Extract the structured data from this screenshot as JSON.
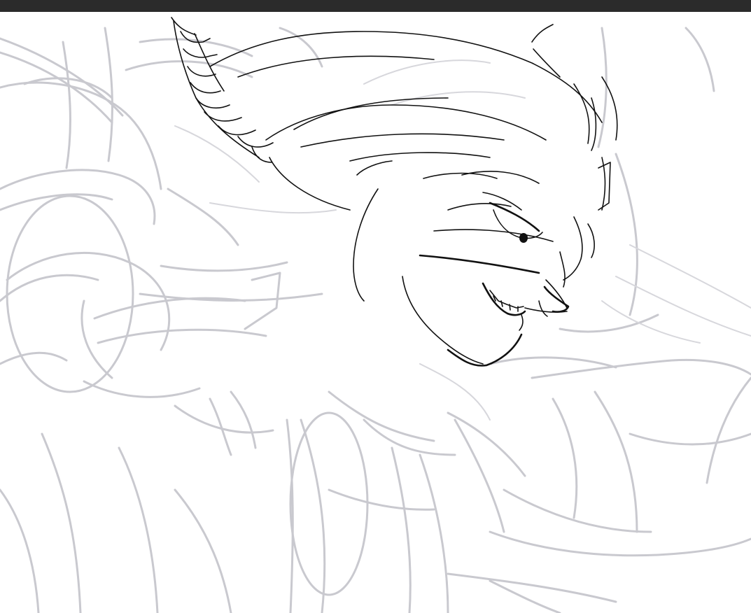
{
  "app": {
    "top_bar_color": "#2b2b2b",
    "canvas_background": "#ffffff"
  },
  "artwork": {
    "rough_stroke_color": "#c9c9cf",
    "ink_stroke_color": "#111111"
  }
}
